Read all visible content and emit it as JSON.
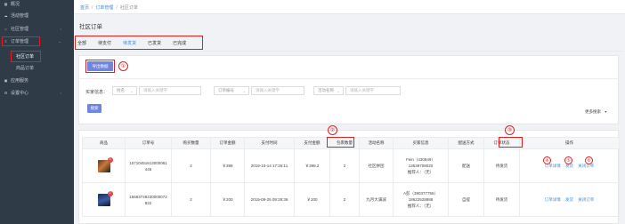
{
  "sidebar": {
    "items": [
      {
        "label": "概况",
        "icon": "grid-icon"
      },
      {
        "label": "活动管理",
        "icon": "cloud-icon"
      },
      {
        "label": "社区管理",
        "icon": "home-icon"
      },
      {
        "label": "订单管理",
        "icon": "list-icon"
      },
      {
        "label": "社区订单"
      },
      {
        "label": "商品订单"
      },
      {
        "label": "应用服务",
        "icon": "apps-icon"
      },
      {
        "label": "设置中心",
        "icon": "gear-icon"
      }
    ]
  },
  "breadcrumb": {
    "home": "首页",
    "parent": "订单管理",
    "current": "社区订单",
    "sep": "/"
  },
  "page_title": "社区订单",
  "tabs": [
    "全部",
    "待支付",
    "待发货",
    "已发货",
    "已完成"
  ],
  "toolbar": {
    "export_label": "导出数据"
  },
  "filters": {
    "buyer_label": "买家信息：",
    "buyer_select": "姓名",
    "buyer_placeholder": "请输入关键字",
    "order_select": "订单编号",
    "order_placeholder": "请输入关键字",
    "activity_select": "活动名称",
    "activity_placeholder": "请输入关键字",
    "search_label": "搜索",
    "more_label": "更多搜索"
  },
  "annotations": {
    "n1": "①",
    "n2": "②",
    "n3": "③",
    "n4": "④",
    "n5": "⑤",
    "n6": "⑥"
  },
  "table": {
    "headers": [
      "商品",
      "订单号",
      "购买数量",
      "订单金额",
      "支付时间",
      "支付金额",
      "包裹数量",
      "活动名称",
      "买家信息",
      "配送方式",
      "订单状态",
      "操作"
    ],
    "rows": [
      {
        "badge": "3",
        "order_no_1": "15710451613000061",
        "order_no_2": "445",
        "qty": "2",
        "amount": "￥398",
        "pay_time": "2019-10-14 17:26:11",
        "pay_amount": "￥398.2",
        "packages": "2",
        "activity": "社区拼团",
        "buyer_1": "Fein（430849）",
        "buyer_2": "13539708020",
        "buyer_3": "推荐人：（无）",
        "delivery": "配送",
        "status": "待发货",
        "op_detail": "订单详情",
        "op_ship": "发货",
        "op_close": "关闭订单"
      },
      {
        "badge": "2",
        "order_no_1": "15693748230000072",
        "order_no_2": "822",
        "qty": "2",
        "amount": "￥200",
        "pay_time": "2019-09-25 09:28:36",
        "pay_amount": "￥200",
        "packages": "2",
        "activity": "九月大满减",
        "buyer_1": "A彭（390377755）",
        "buyer_2": "18622528888",
        "buyer_3": "推荐人：（无）",
        "delivery": "自提",
        "status": "待发货",
        "op_detail": "订单详情",
        "op_ship": "发货",
        "op_close": "关闭订单"
      }
    ]
  },
  "colors": {
    "accent": "#3d8bd8",
    "button": "#6f86e0",
    "sidebar": "#2f3b47",
    "annotation": "#e02020"
  }
}
